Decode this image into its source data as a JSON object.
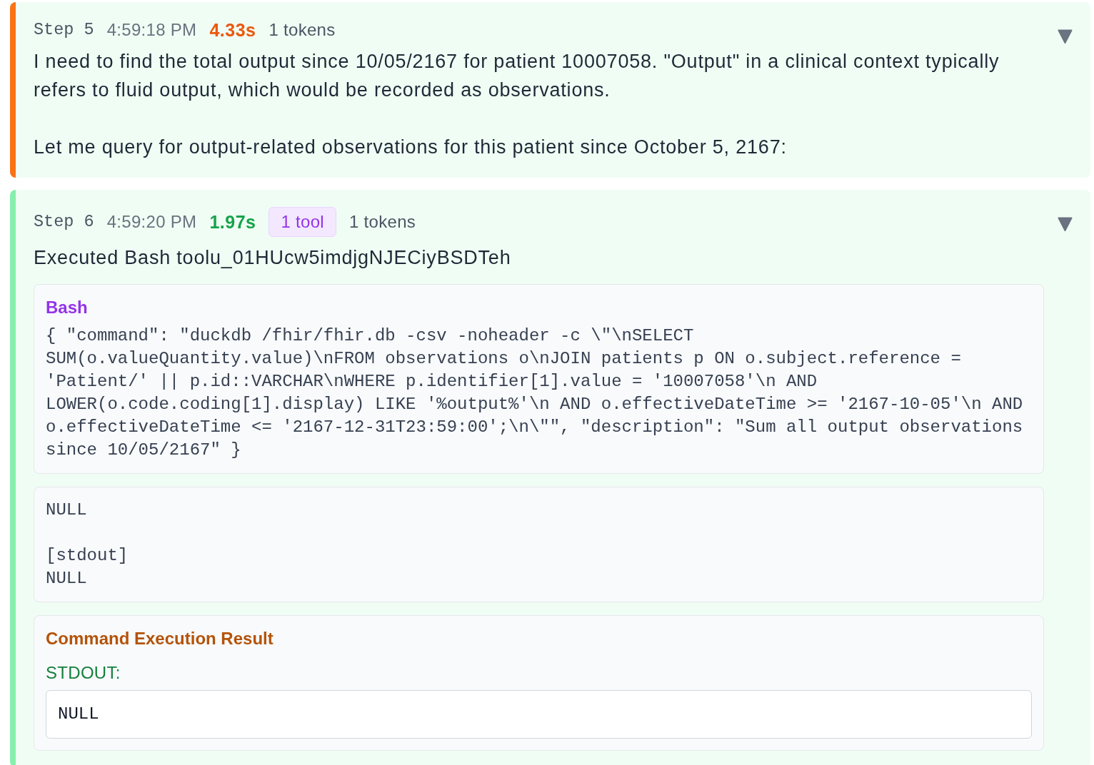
{
  "steps": [
    {
      "label": "Step 5",
      "time": "4:59:18 PM",
      "duration": {
        "text": "4.33s",
        "color": "#ea580c"
      },
      "tokens": "1 tokens",
      "color": "#f97316",
      "expanded": true,
      "paragraphs": [
        "I need to find the total output since 10/05/2167 for patient 10007058. \"Output\" in a clinical context typically refers to fluid output, which would be recorded as observations.",
        "Let me query for output-related observations for this patient since October 5, 2167:"
      ]
    },
    {
      "label": "Step 6",
      "time": "4:59:20 PM",
      "duration": {
        "text": "1.97s",
        "color": "#16a34a"
      },
      "tool_badge": "1 tool",
      "tokens": "1 tokens",
      "color": "#86efac",
      "expanded": true,
      "paragraphs": [
        "Executed Bash toolu_01HUcw5imdjgNJECiyBSDTeh"
      ],
      "tool_call": {
        "name": "Bash",
        "input": "{ \"command\": \"duckdb /fhir/fhir.db -csv -noheader -c \\\"\\nSELECT\nSUM(o.valueQuantity.value)\\nFROM observations o\\nJOIN patients p ON o.subject.reference = 'Patient/' || p.id::VARCHAR\\nWHERE p.identifier[1].value = '10007058'\\n AND LOWER(o.code.coding[1].display) LIKE '%output%'\\n AND o.effectiveDateTime >= '2167-10-05'\\n AND o.effectiveDateTime <= '2167-12-31T23:59:00';\\n\\\"\", \"description\": \"Sum all output observations since 10/05/2167\" }"
      },
      "output": "NULL\n\n[stdout]\nNULL",
      "result": {
        "title": "Command Execution Result",
        "stdout_label": "STDOUT:",
        "stdout": "NULL"
      }
    }
  ]
}
